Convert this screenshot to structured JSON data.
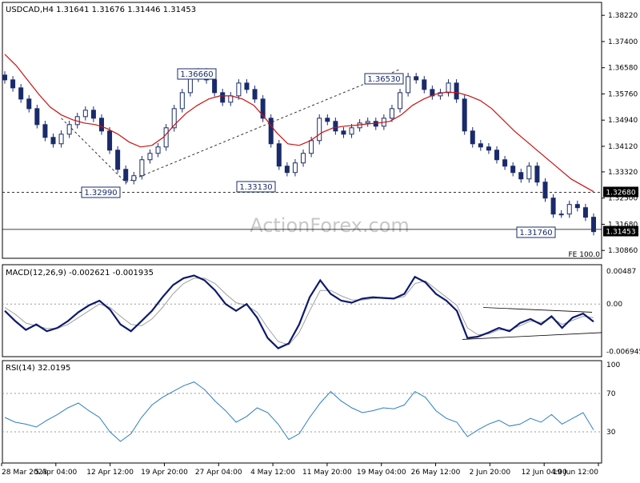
{
  "header": {
    "symbol_line": "USDCAD,H4  1.31641 1.31676 1.31446 1.31453"
  },
  "watermark": "ActionForex.com",
  "colors": {
    "candle": "#1a2b6b",
    "ma": "#cc1111",
    "macd": "#0d1a6e",
    "signal": "#a0a0a0",
    "rsi": "#2b7fc1",
    "tag_border": "#1a2b6b",
    "price_tag_bg": "#000000"
  },
  "chart_data": [
    {
      "type": "line",
      "name": "price",
      "description_type": "candlestick",
      "x_labels": [
        "28 Mar 2023",
        "5 Apr 04:00",
        "12 Apr 12:00",
        "19 Apr 20:00",
        "27 Apr 04:00",
        "4 May 12:00",
        "11 May 20:00",
        "19 May 04:00",
        "26 May 12:00",
        "2 Jun 20:00",
        "12 Jun 04:00",
        "19 Jun 12:00"
      ],
      "y_ticks": [
        "1.38220",
        "1.37400",
        "1.36580",
        "1.35760",
        "1.34940",
        "1.34120",
        "1.33320",
        "1.32500",
        "1.31680",
        "1.30860"
      ],
      "ylim": [
        1.3069,
        1.3855
      ],
      "close": [
        1.362,
        1.3595,
        1.356,
        1.353,
        1.348,
        1.344,
        1.342,
        1.345,
        1.348,
        1.3505,
        1.3525,
        1.35,
        1.346,
        1.34,
        1.334,
        1.3305,
        1.332,
        1.337,
        1.339,
        1.341,
        1.347,
        1.353,
        1.358,
        1.3625,
        1.3645,
        1.362,
        1.358,
        1.355,
        1.357,
        1.361,
        1.359,
        1.356,
        1.35,
        1.342,
        1.335,
        1.333,
        1.336,
        1.339,
        1.343,
        1.35,
        1.349,
        1.346,
        1.345,
        1.347,
        1.3485,
        1.349,
        1.3475,
        1.35,
        1.353,
        1.358,
        1.363,
        1.362,
        1.359,
        1.357,
        1.358,
        1.361,
        1.356,
        1.346,
        1.342,
        1.341,
        1.34,
        1.337,
        1.335,
        1.333,
        1.331,
        1.335,
        1.33,
        1.325,
        1.32,
        1.32,
        1.323,
        1.322,
        1.319,
        1.3145
      ],
      "ma": [
        1.37,
        1.3665,
        1.362,
        1.3575,
        1.3535,
        1.351,
        1.3495,
        1.3485,
        1.348,
        1.3468,
        1.345,
        1.3425,
        1.341,
        1.3415,
        1.344,
        1.348,
        1.3515,
        1.354,
        1.356,
        1.357,
        1.357,
        1.356,
        1.354,
        1.35,
        1.3455,
        1.342,
        1.3415,
        1.343,
        1.3455,
        1.347,
        1.3475,
        1.3478,
        1.3482,
        1.3485,
        1.349,
        1.351,
        1.354,
        1.356,
        1.3575,
        1.3582,
        1.358,
        1.357,
        1.3555,
        1.353,
        1.3495,
        1.346,
        1.343,
        1.34,
        1.337,
        1.334,
        1.331,
        1.329,
        1.327
      ],
      "ma_x_fractions_note": "ma points are evenly spread across the plot width",
      "annotations": [
        {
          "label": "1.36660",
          "value": 1.3666
        },
        {
          "label": "1.36530",
          "value": 1.3653
        },
        {
          "label": "1.32990",
          "value": 1.3299
        },
        {
          "label": "1.33130",
          "value": 1.3313
        },
        {
          "label": "1.31760",
          "value": 1.3176
        }
      ],
      "hline": {
        "label": "1.32680",
        "value": 1.3268
      },
      "last_price": {
        "label": "1.31453",
        "value": 1.31453
      },
      "fe_label": "FE 100.0"
    },
    {
      "type": "line",
      "name": "MACD",
      "title": "MACD(12,26,9) -0.002621 -0.001935",
      "y_ticks": [
        "0.00487",
        "0.00",
        "-0.006945"
      ],
      "ylim": [
        -0.0075,
        0.0052
      ],
      "macd": [
        -0.001,
        -0.0025,
        -0.0038,
        -0.003,
        -0.004,
        -0.0035,
        -0.0025,
        -0.0012,
        -0.0002,
        0.0005,
        -0.0008,
        -0.003,
        -0.004,
        -0.0025,
        -0.001,
        0.001,
        0.0028,
        0.0038,
        0.0042,
        0.0035,
        0.002,
        0.0,
        -0.001,
        0.0,
        -0.002,
        -0.005,
        -0.0065,
        -0.0058,
        -0.003,
        0.001,
        0.0035,
        0.0015,
        0.0005,
        0.0002,
        0.0008,
        0.001,
        0.0009,
        0.0008,
        0.0015,
        0.004,
        0.0032,
        0.0015,
        0.0005,
        -0.001,
        -0.005,
        -0.0048,
        -0.0042,
        -0.0035,
        -0.004,
        -0.0028,
        -0.0022,
        -0.003,
        -0.0018,
        -0.0035,
        -0.002,
        -0.0014,
        -0.0026
      ],
      "signal": [
        -0.0005,
        -0.0015,
        -0.0028,
        -0.0032,
        -0.0036,
        -0.0036,
        -0.003,
        -0.002,
        -0.001,
        0.0,
        -0.0005,
        -0.0018,
        -0.003,
        -0.0032,
        -0.0022,
        -0.0005,
        0.0015,
        0.003,
        0.0038,
        0.0038,
        0.003,
        0.0015,
        0.0002,
        -0.0002,
        -0.0012,
        -0.0035,
        -0.0055,
        -0.006,
        -0.0042,
        -0.001,
        0.002,
        0.002,
        0.0012,
        0.0006,
        0.0006,
        0.0008,
        0.0009,
        0.0008,
        0.0011,
        0.003,
        0.0034,
        0.0022,
        0.001,
        -0.0002,
        -0.0035,
        -0.0045,
        -0.0044,
        -0.0038,
        -0.0038,
        -0.0032,
        -0.0025,
        -0.0027,
        -0.002,
        -0.003,
        -0.0024,
        -0.0018,
        -0.002
      ]
    },
    {
      "type": "line",
      "name": "RSI",
      "title": "RSI(14) 32.0195",
      "y_ticks": [
        "100",
        "70",
        "30"
      ],
      "ylim": [
        0,
        100
      ],
      "values": [
        45,
        40,
        38,
        35,
        42,
        48,
        55,
        60,
        52,
        45,
        30,
        20,
        28,
        45,
        58,
        66,
        72,
        78,
        82,
        74,
        62,
        52,
        40,
        46,
        55,
        50,
        38,
        22,
        28,
        45,
        60,
        72,
        62,
        55,
        50,
        52,
        55,
        54,
        58,
        72,
        66,
        52,
        44,
        40,
        25,
        32,
        38,
        42,
        36,
        38,
        44,
        40,
        48,
        38,
        44,
        50,
        32
      ]
    }
  ]
}
